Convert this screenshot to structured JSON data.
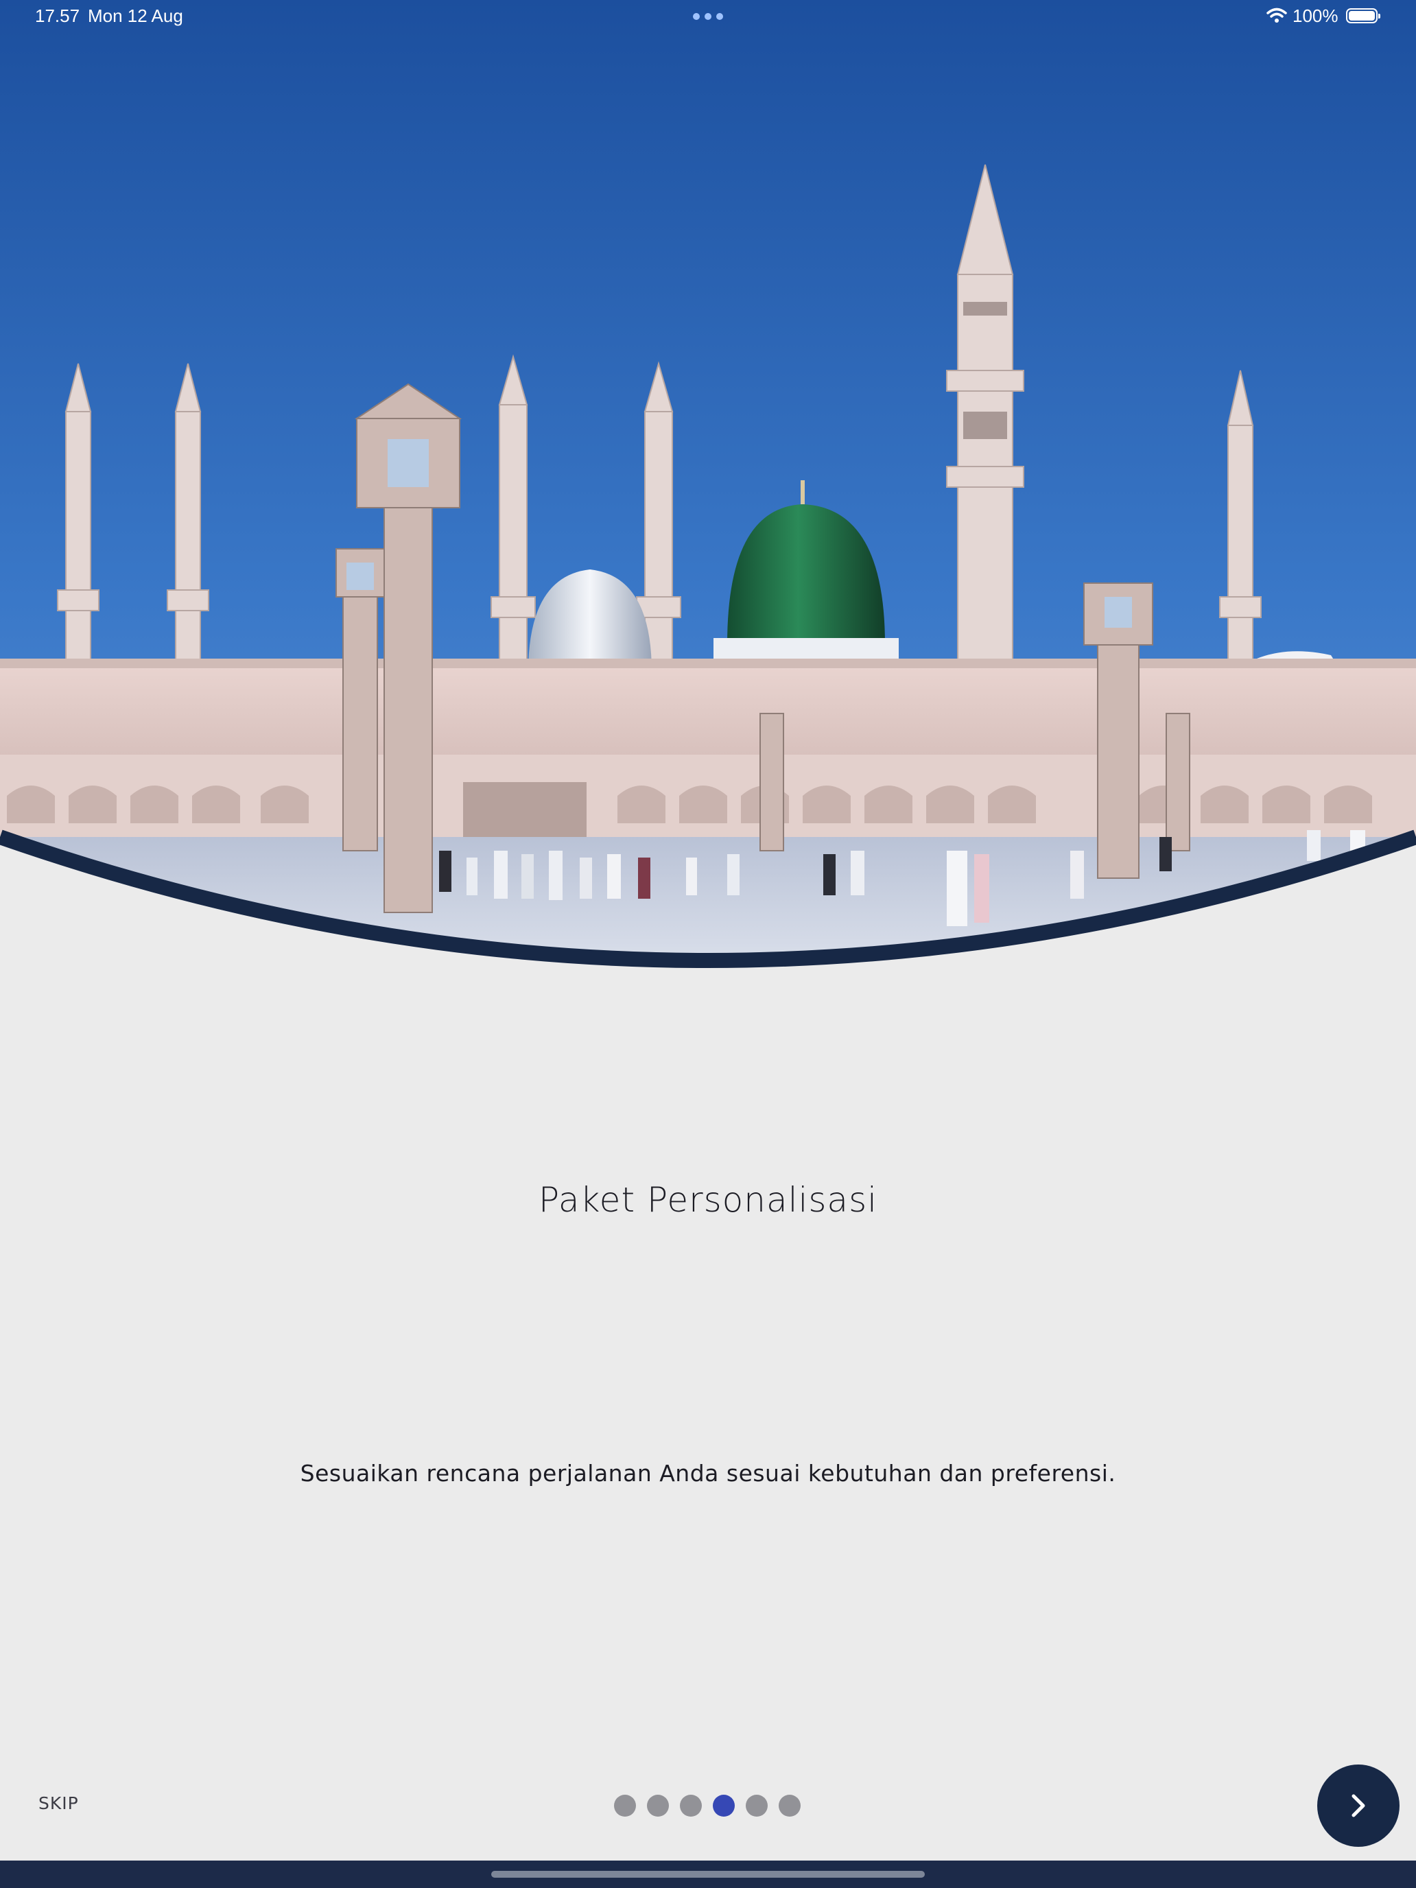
{
  "status_bar": {
    "time": "17.57",
    "date": "Mon 12 Aug",
    "battery": "100%"
  },
  "hero": {
    "image": "mosque-with-green-dome-photo",
    "colors": {
      "sky": "#2e6bc2",
      "curve_border": "#172846",
      "dome": "#1f6d45"
    }
  },
  "onboarding": {
    "title": "Paket Personalisasi",
    "description": "Sesuaikan rencana perjalanan Anda sesuai kebutuhan dan preferensi.",
    "skip_label": "SKIP",
    "pages_total": 6,
    "current_page": 4,
    "next_icon": "chevron-right-icon"
  },
  "colors": {
    "background": "#ebebeb",
    "accent": "#3648b5",
    "button": "#172846",
    "dot_inactive": "#929297"
  }
}
